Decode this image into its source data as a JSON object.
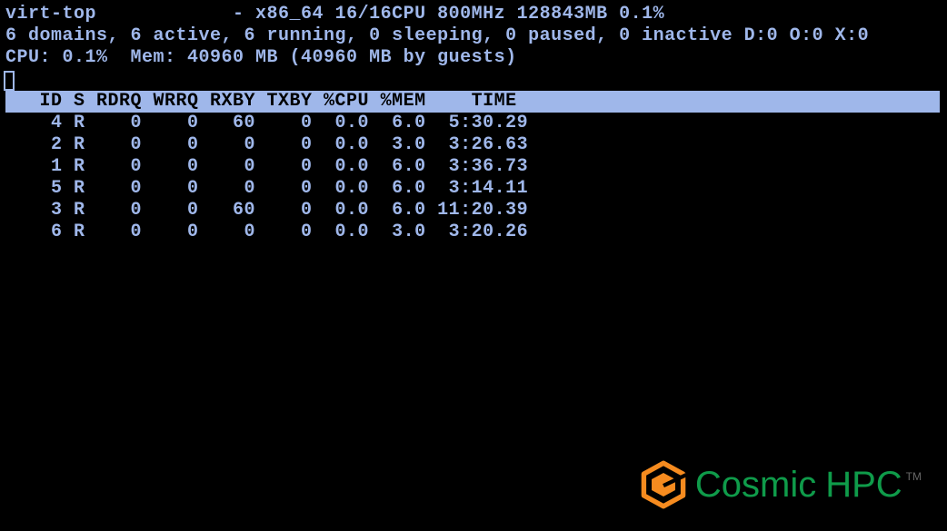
{
  "header": {
    "program": "virt-top",
    "sysinfo": "- x86_64 16/16CPU 800MHz 128843MB 0.1%",
    "summary": "6 domains, 6 active, 6 running, 0 sleeping, 0 paused, 0 inactive D:0 O:0 X:0",
    "usage": "CPU: 0.1%  Mem: 40960 MB (40960 MB by guests)"
  },
  "columns": {
    "line": "   ID S RDRQ WRRQ RXBY TXBY %CPU %MEM    TIME"
  },
  "rows": [
    {
      "id": "4",
      "s": "R",
      "rdrq": "0",
      "wrrq": "0",
      "rxby": "60",
      "txby": "0",
      "cpu": "0.0",
      "mem": "6.0",
      "time": "5:30.29"
    },
    {
      "id": "2",
      "s": "R",
      "rdrq": "0",
      "wrrq": "0",
      "rxby": "0",
      "txby": "0",
      "cpu": "0.0",
      "mem": "3.0",
      "time": "3:26.63"
    },
    {
      "id": "1",
      "s": "R",
      "rdrq": "0",
      "wrrq": "0",
      "rxby": "0",
      "txby": "0",
      "cpu": "0.0",
      "mem": "6.0",
      "time": "3:36.73"
    },
    {
      "id": "5",
      "s": "R",
      "rdrq": "0",
      "wrrq": "0",
      "rxby": "0",
      "txby": "0",
      "cpu": "0.0",
      "mem": "6.0",
      "time": "3:14.11"
    },
    {
      "id": "3",
      "s": "R",
      "rdrq": "0",
      "wrrq": "0",
      "rxby": "60",
      "txby": "0",
      "cpu": "0.0",
      "mem": "6.0",
      "time": "11:20.39"
    },
    {
      "id": "6",
      "s": "R",
      "rdrq": "0",
      "wrrq": "0",
      "rxby": "0",
      "txby": "0",
      "cpu": "0.0",
      "mem": "3.0",
      "time": "3:20.26"
    }
  ],
  "logo": {
    "brand": "Cosmic",
    "suffix": "HPC",
    "tm": "TM"
  }
}
